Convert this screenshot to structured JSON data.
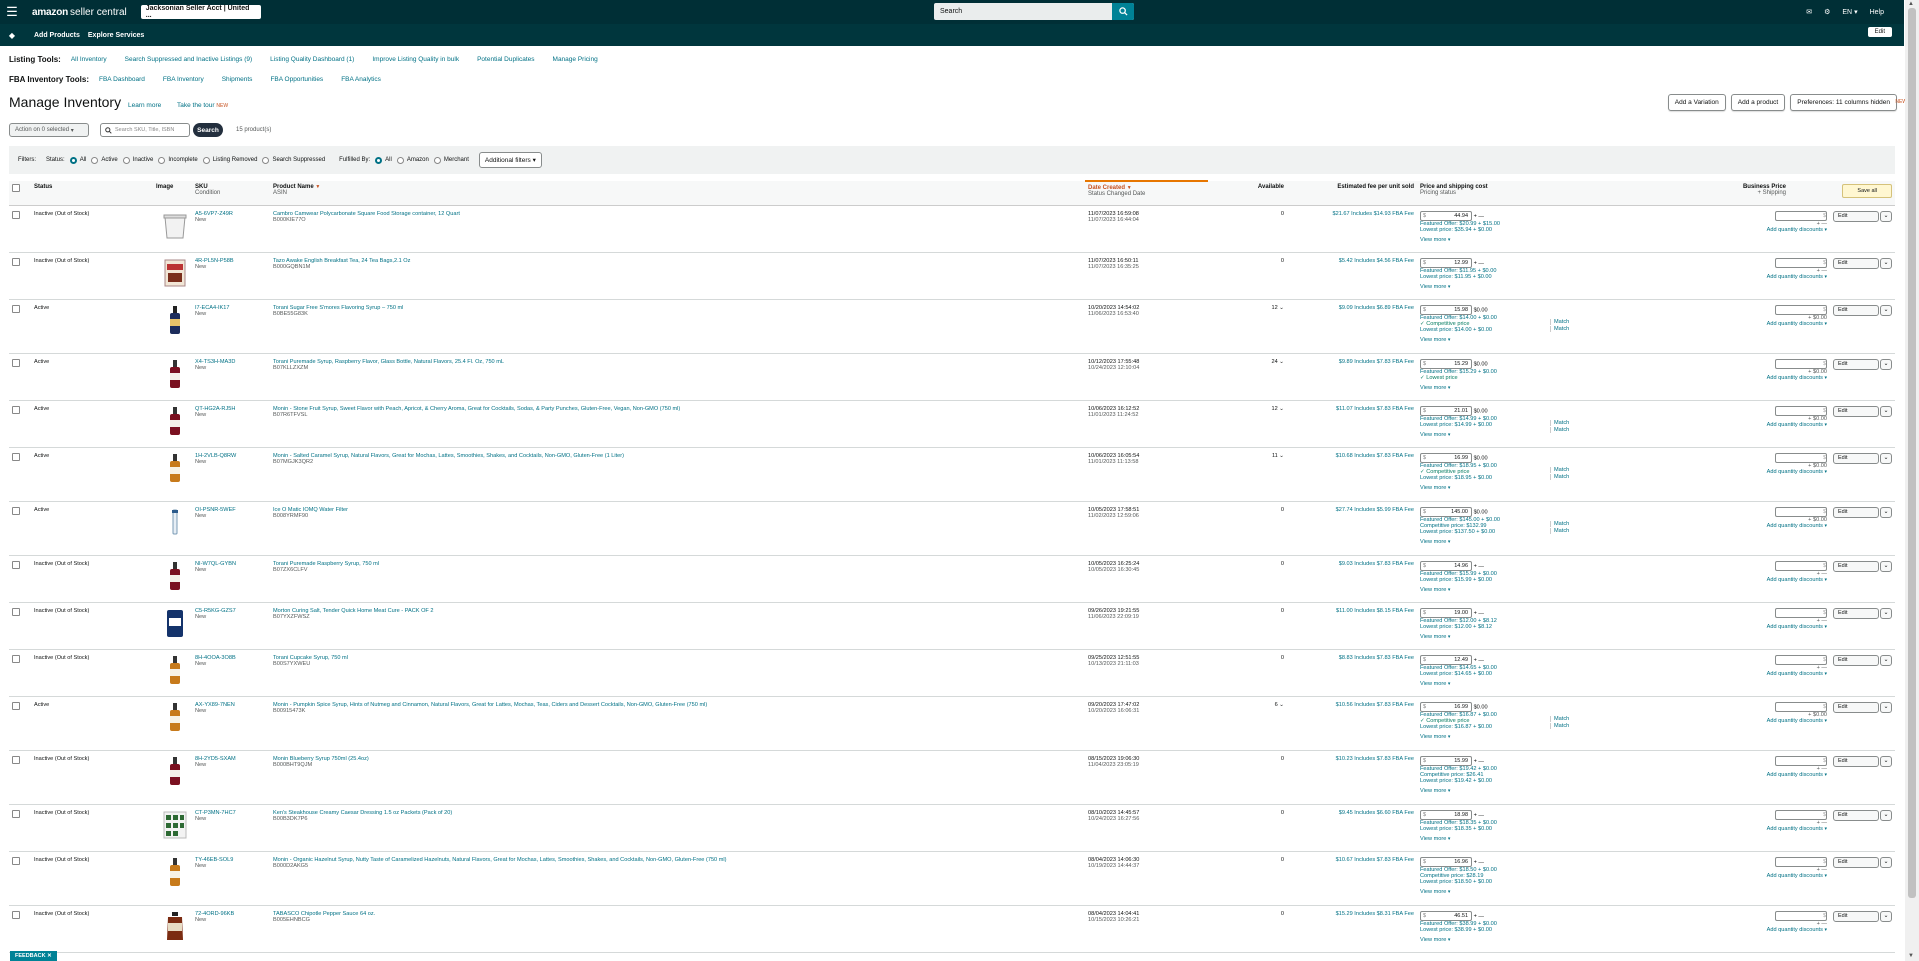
{
  "topbar": {
    "logo_bold": "amazon",
    "logo_rest": "seller central",
    "account": "Jacksonian Seller Acct | United ...",
    "search_placeholder": "Search",
    "lang": "EN",
    "help": "Help"
  },
  "navbar": {
    "add_products": "Add Products",
    "explore_services": "Explore Services",
    "edit": "Edit"
  },
  "listing_tools": {
    "label": "Listing Tools:",
    "links": [
      "All Inventory",
      "Search Suppressed and Inactive Listings (9)",
      "Listing Quality Dashboard (1)",
      "Improve Listing Quality in bulk",
      "Potential Duplicates",
      "Manage Pricing"
    ]
  },
  "fba_tools": {
    "label": "FBA Inventory Tools:",
    "links": [
      "FBA Dashboard",
      "FBA Inventory",
      "Shipments",
      "FBA Opportunities",
      "FBA Analytics"
    ]
  },
  "page": {
    "title": "Manage Inventory",
    "learn_more": "Learn more",
    "tour": "Take the tour",
    "tour_new": "NEW",
    "add_variation": "Add a Variation",
    "add_product": "Add a product",
    "preferences": "Preferences: 11 columns hidden",
    "pref_new": "NEW",
    "action_select": "Action on 0 selected",
    "search_placeholder": "Search SKU, Title, ISBN",
    "search_btn": "Search",
    "product_count": "15 product(s)"
  },
  "filters": {
    "label": "Filters:",
    "status_label": "Status:",
    "status_options": [
      "All",
      "Active",
      "Inactive",
      "Incomplete",
      "Listing Removed",
      "Search Suppressed"
    ],
    "fulfilled_label": "Fulfilled By:",
    "fulfilled_options": [
      "All",
      "Amazon",
      "Merchant"
    ],
    "additional": "Additional filters"
  },
  "columns": {
    "status": "Status",
    "image": "Image",
    "sku": "SKU",
    "sku_sub": "Condition",
    "name": "Product Name",
    "name_sub": "ASIN",
    "date": "Date Created",
    "date_sub": "Status Changed Date",
    "available": "Available",
    "fee": "Estimated fee per unit sold",
    "price": "Price and shipping cost",
    "price_sub": "Pricing status",
    "business": "Business Price",
    "business_sub": "+ Shipping",
    "save_all": "Save all"
  },
  "common": {
    "view_more": "View more",
    "add_qty": "Add quantity discounts",
    "edit": "Edit",
    "match": "Match",
    "new": "New",
    "shipping_dash": "+ —",
    "ship_zero": "+ $0.00",
    "dollar": "$"
  },
  "rows": [
    {
      "status": "Inactive (Out of Stock)",
      "sku": "A5-6VP7-Z49R",
      "name": "Cambro Camwear Polycarbonate Square Food Storage container, 12 Quart",
      "asin": "B000KIE77O",
      "created": "11/07/2023 16:59:08",
      "changed": "11/07/2023 16:44:04",
      "avail": "0",
      "fee": "$21.67 Includes $14.93 FBA Fee",
      "price": "44.94",
      "ship": "—",
      "featured": "Featured Offer: $20.99 + $15.00",
      "line2": "Lowest price: $35.94 + $0.00",
      "line3": "",
      "m2": false,
      "m3": false,
      "img": "container"
    },
    {
      "status": "Inactive (Out of Stock)",
      "sku": "4R-PL5N-P58B",
      "name": "Tazo Awake English Breakfast Tea, 24 Tea Bags,2.1 Oz",
      "asin": "B000GQBN1M",
      "created": "11/07/2023 16:50:11",
      "changed": "11/07/2023 16:35:25",
      "avail": "0",
      "fee": "$5.42 Includes $4.56 FBA Fee",
      "price": "12.99",
      "ship": "—",
      "featured": "Featured Offer: $11.95 + $0.00",
      "line2": "Lowest price: $11.95 + $0.00",
      "line3": "",
      "m2": false,
      "m3": false,
      "img": "box"
    },
    {
      "status": "Active",
      "sku": "I7-ECA4-IK17",
      "name": "Torani Sugar Free S'mores Flavoring Syrup – 750 ml",
      "asin": "B0BE55G83K",
      "created": "10/20/2023 14:54:02",
      "changed": "11/06/2023 16:53:40",
      "avail": "12",
      "fee": "$9.09 Includes $6.89 FBA Fee",
      "price": "15.98",
      "ship": "$0.00",
      "featured": "Featured Offer: $14.00 + $0.00",
      "line2": "✓ Competitive price",
      "line3": "Lowest price: $14.00 + $0.00",
      "m2": true,
      "m3": true,
      "img": "bottle"
    },
    {
      "status": "Active",
      "sku": "X4-TS3H-MA3D",
      "name": "Torani Puremade Syrup, Raspberry Flavor, Glass Bottle, Natural Flavors, 25.4 Fl. Oz, 750 mL",
      "asin": "B07KLLZXZM",
      "created": "10/12/2023 17:55:48",
      "changed": "10/24/2023 12:10:04",
      "avail": "24",
      "fee": "$9.89 Includes $7.83 FBA Fee",
      "price": "15.29",
      "ship": "$0.00",
      "featured": "Featured Offer: $15.29 + $0.00",
      "line2": "✓ Lowest price",
      "line3": "",
      "m2": false,
      "m3": false,
      "img": "bottle-red"
    },
    {
      "status": "Active",
      "sku": "QT-HG2A-RJ5H",
      "name": "Monin - Stone Fruit Syrup, Sweet Flavor with Peach, Apricot, & Cherry Aroma, Great for Cocktails, Sodas, & Party Punches, Gluten-Free, Vegan, Non-GMO (750 ml)",
      "asin": "B07R6TFVSL",
      "created": "10/06/2023 16:12:52",
      "changed": "11/01/2023 11:24:52",
      "avail": "12",
      "fee": "$11.07 Includes $7.83 FBA Fee",
      "price": "21.01",
      "ship": "$0.00",
      "featured": "Featured Offer: $14.99 + $0.00",
      "line2": "Lowest price: $14.99 + $0.00",
      "line3": "",
      "m2": true,
      "m3": true,
      "img": "bottle-red"
    },
    {
      "status": "Active",
      "sku": "1H-2VLB-Q8RW",
      "name": "Monin - Salted Caramel Syrup, Natural Flavors, Great for Mochas, Lattes, Smoothies, Shakes, and Cocktails, Non-GMO, Gluten-Free (1 Liter)",
      "asin": "B07MGJK3QR2",
      "created": "10/06/2023 16:05:54",
      "changed": "11/01/2023 11:13:58",
      "avail": "11",
      "fee": "$10.68 Includes $7.83 FBA Fee",
      "price": "16.99",
      "ship": "$0.00",
      "featured": "Featured Offer: $18.95 + $0.00",
      "line2": "✓ Competitive price",
      "line3": "Lowest price: $18.95 + $0.00",
      "m2": true,
      "m3": true,
      "img": "bottle-amber"
    },
    {
      "status": "Active",
      "sku": "OI-PSNR-5WEF",
      "name": "Ice O Matic IOMQ Water Filter",
      "asin": "B008YRMF90",
      "created": "10/05/2023 17:58:51",
      "changed": "11/02/2023 12:59:06",
      "avail": "0",
      "fee": "$27.74 Includes $5.99 FBA Fee",
      "price": "145.00",
      "ship": "$0.00",
      "featured": "Featured Offer: $145.00 + $0.00",
      "line2": "Competitive price: $132.99",
      "line3": "Lowest price: $137.50 + $0.00",
      "m2": true,
      "m3": true,
      "img": "filter"
    },
    {
      "status": "Inactive (Out of Stock)",
      "sku": "NI-W7QL-GYBN",
      "name": "Torani Puremade Raspberry Syrup, 750 ml",
      "asin": "B07ZX6CLFV",
      "created": "10/05/2023 16:25:24",
      "changed": "10/05/2023 16:30:45",
      "avail": "0",
      "fee": "$9.03 Includes $7.83 FBA Fee",
      "price": "14.96",
      "ship": "—",
      "featured": "Featured Offer: $15.99 + $0.00",
      "line2": "Lowest price: $15.99 + $0.00",
      "line3": "",
      "m2": false,
      "m3": false,
      "img": "bottle-red"
    },
    {
      "status": "Inactive (Out of Stock)",
      "sku": "C5-R5KG-GZS7",
      "name": "Morton Curing Salt, Tender Quick Home Meat Cure - PACK OF 2",
      "asin": "B07YXZFWSZ",
      "created": "09/26/2023 19:21:55",
      "changed": "11/06/2023 22:09:19",
      "avail": "0",
      "fee": "$11.00 Includes $8.15 FBA Fee",
      "price": "19.00",
      "ship": "—",
      "featured": "Featured Offer: $12.00 + $8.12",
      "line2": "Lowest price: $12.00 + $8.12",
      "line3": "",
      "m2": false,
      "m3": false,
      "img": "bag"
    },
    {
      "status": "Inactive (Out of Stock)",
      "sku": "8H-4OOA-3O8B",
      "name": "Torani Cupcake Syrup, 750 ml",
      "asin": "B00S7YXWEU",
      "created": "09/25/2023 12:51:55",
      "changed": "10/13/2023 21:11:03",
      "avail": "0",
      "fee": "$8.83 Includes $7.83 FBA Fee",
      "price": "12.49",
      "ship": "—",
      "featured": "Featured Offer: $14.65 + $0.00",
      "line2": "Lowest price: $14.65 + $0.00",
      "line3": "",
      "m2": false,
      "m3": false,
      "img": "bottle-amber"
    },
    {
      "status": "Active",
      "sku": "AX-YX89-7NEN",
      "name": "Monin - Pumpkin Spice Syrup, Hints of Nutmeg and Cinnamon, Natural Flavors, Great for Lattes, Mochas, Teas, Ciders and Dessert Cocktails, Non-GMO, Gluten-Free (750 ml)",
      "asin": "B00915473K",
      "created": "09/20/2023 17:47:02",
      "changed": "10/20/2023 16:06:31",
      "avail": "6",
      "fee": "$10.56 Includes $7.83 FBA Fee",
      "price": "16.99",
      "ship": "$0.00",
      "featured": "Featured Offer: $16.87 + $0.00",
      "line2": "✓ Competitive price",
      "line3": "Lowest price: $16.87 + $0.00",
      "m2": true,
      "m3": true,
      "img": "bottle-amber"
    },
    {
      "status": "Inactive (Out of Stock)",
      "sku": "8H-2YD5-SXAM",
      "name": "Monin Blueberry Syrup 750ml (25.4oz)",
      "asin": "B000BHT9QJM",
      "created": "08/15/2023 19:06:30",
      "changed": "11/04/2023 23:05:19",
      "avail": "0",
      "fee": "$10.23 Includes $7.83 FBA Fee",
      "price": "15.99",
      "ship": "—",
      "featured": "Featured Offer: $19.42 + $0.00",
      "line2": "Competitive price: $26.41",
      "line3": "Lowest price: $19.42 + $0.00",
      "m2": false,
      "m3": false,
      "img": "bottle-red"
    },
    {
      "status": "Inactive (Out of Stock)",
      "sku": "CT-P3MN-7HC7",
      "name": "Ken's Steakhouse Creamy Caesar Dressing 1.5 oz Packets (Pack of 20)",
      "asin": "B00B3DK7P6",
      "created": "08/10/2023 14:45:57",
      "changed": "10/24/2023 16:27:56",
      "avail": "0",
      "fee": "$9.45 Includes $6.60 FBA Fee",
      "price": "18.98",
      "ship": "—",
      "featured": "Featured Offer: $18.35 + $0.00",
      "line2": "Lowest price: $18.35 + $0.00",
      "line3": "",
      "m2": false,
      "m3": false,
      "img": "packets"
    },
    {
      "status": "Inactive (Out of Stock)",
      "sku": "TY-46EB-SOL9",
      "name": "Monin - Organic Hazelnut Syrup, Nutty Taste of Caramelized Hazelnuts, Natural Flavors, Great for Mochas, Lattes, Smoothies, Shakes, and Cocktails, Non-GMO, Gluten-Free (750 ml)",
      "asin": "B000D2AKG5",
      "created": "08/04/2023 14:06:30",
      "changed": "10/19/2023 14:44:37",
      "avail": "0",
      "fee": "$10.67 Includes $7.83 FBA Fee",
      "price": "16.96",
      "ship": "—",
      "featured": "Featured Offer: $18.50 + $0.00",
      "line2": "Competitive price: $28.19",
      "line3": "Lowest price: $18.50 + $0.00",
      "m2": false,
      "m3": false,
      "img": "bottle-amber"
    },
    {
      "status": "Inactive (Out of Stock)",
      "sku": "72-4ORD-96KB",
      "name": "TABASCO Chipotle Pepper Sauce 64 oz.",
      "asin": "B005EHNBCG",
      "created": "08/04/2023 14:04:41",
      "changed": "10/15/2023 10:26:21",
      "avail": "0",
      "fee": "$15.29 Includes $8.31 FBA Fee",
      "price": "46.51",
      "ship": "—",
      "featured": "Featured Offer: $38.99 + $0.00",
      "line2": "Lowest price: $38.99 + $0.00",
      "line3": "",
      "m2": false,
      "m3": false,
      "img": "jug"
    }
  ],
  "feedback": "FEEDBACK",
  "colors": {
    "topbar": "#002f36",
    "link": "#007185",
    "accent": "#008296",
    "orange": "#c7511f"
  }
}
